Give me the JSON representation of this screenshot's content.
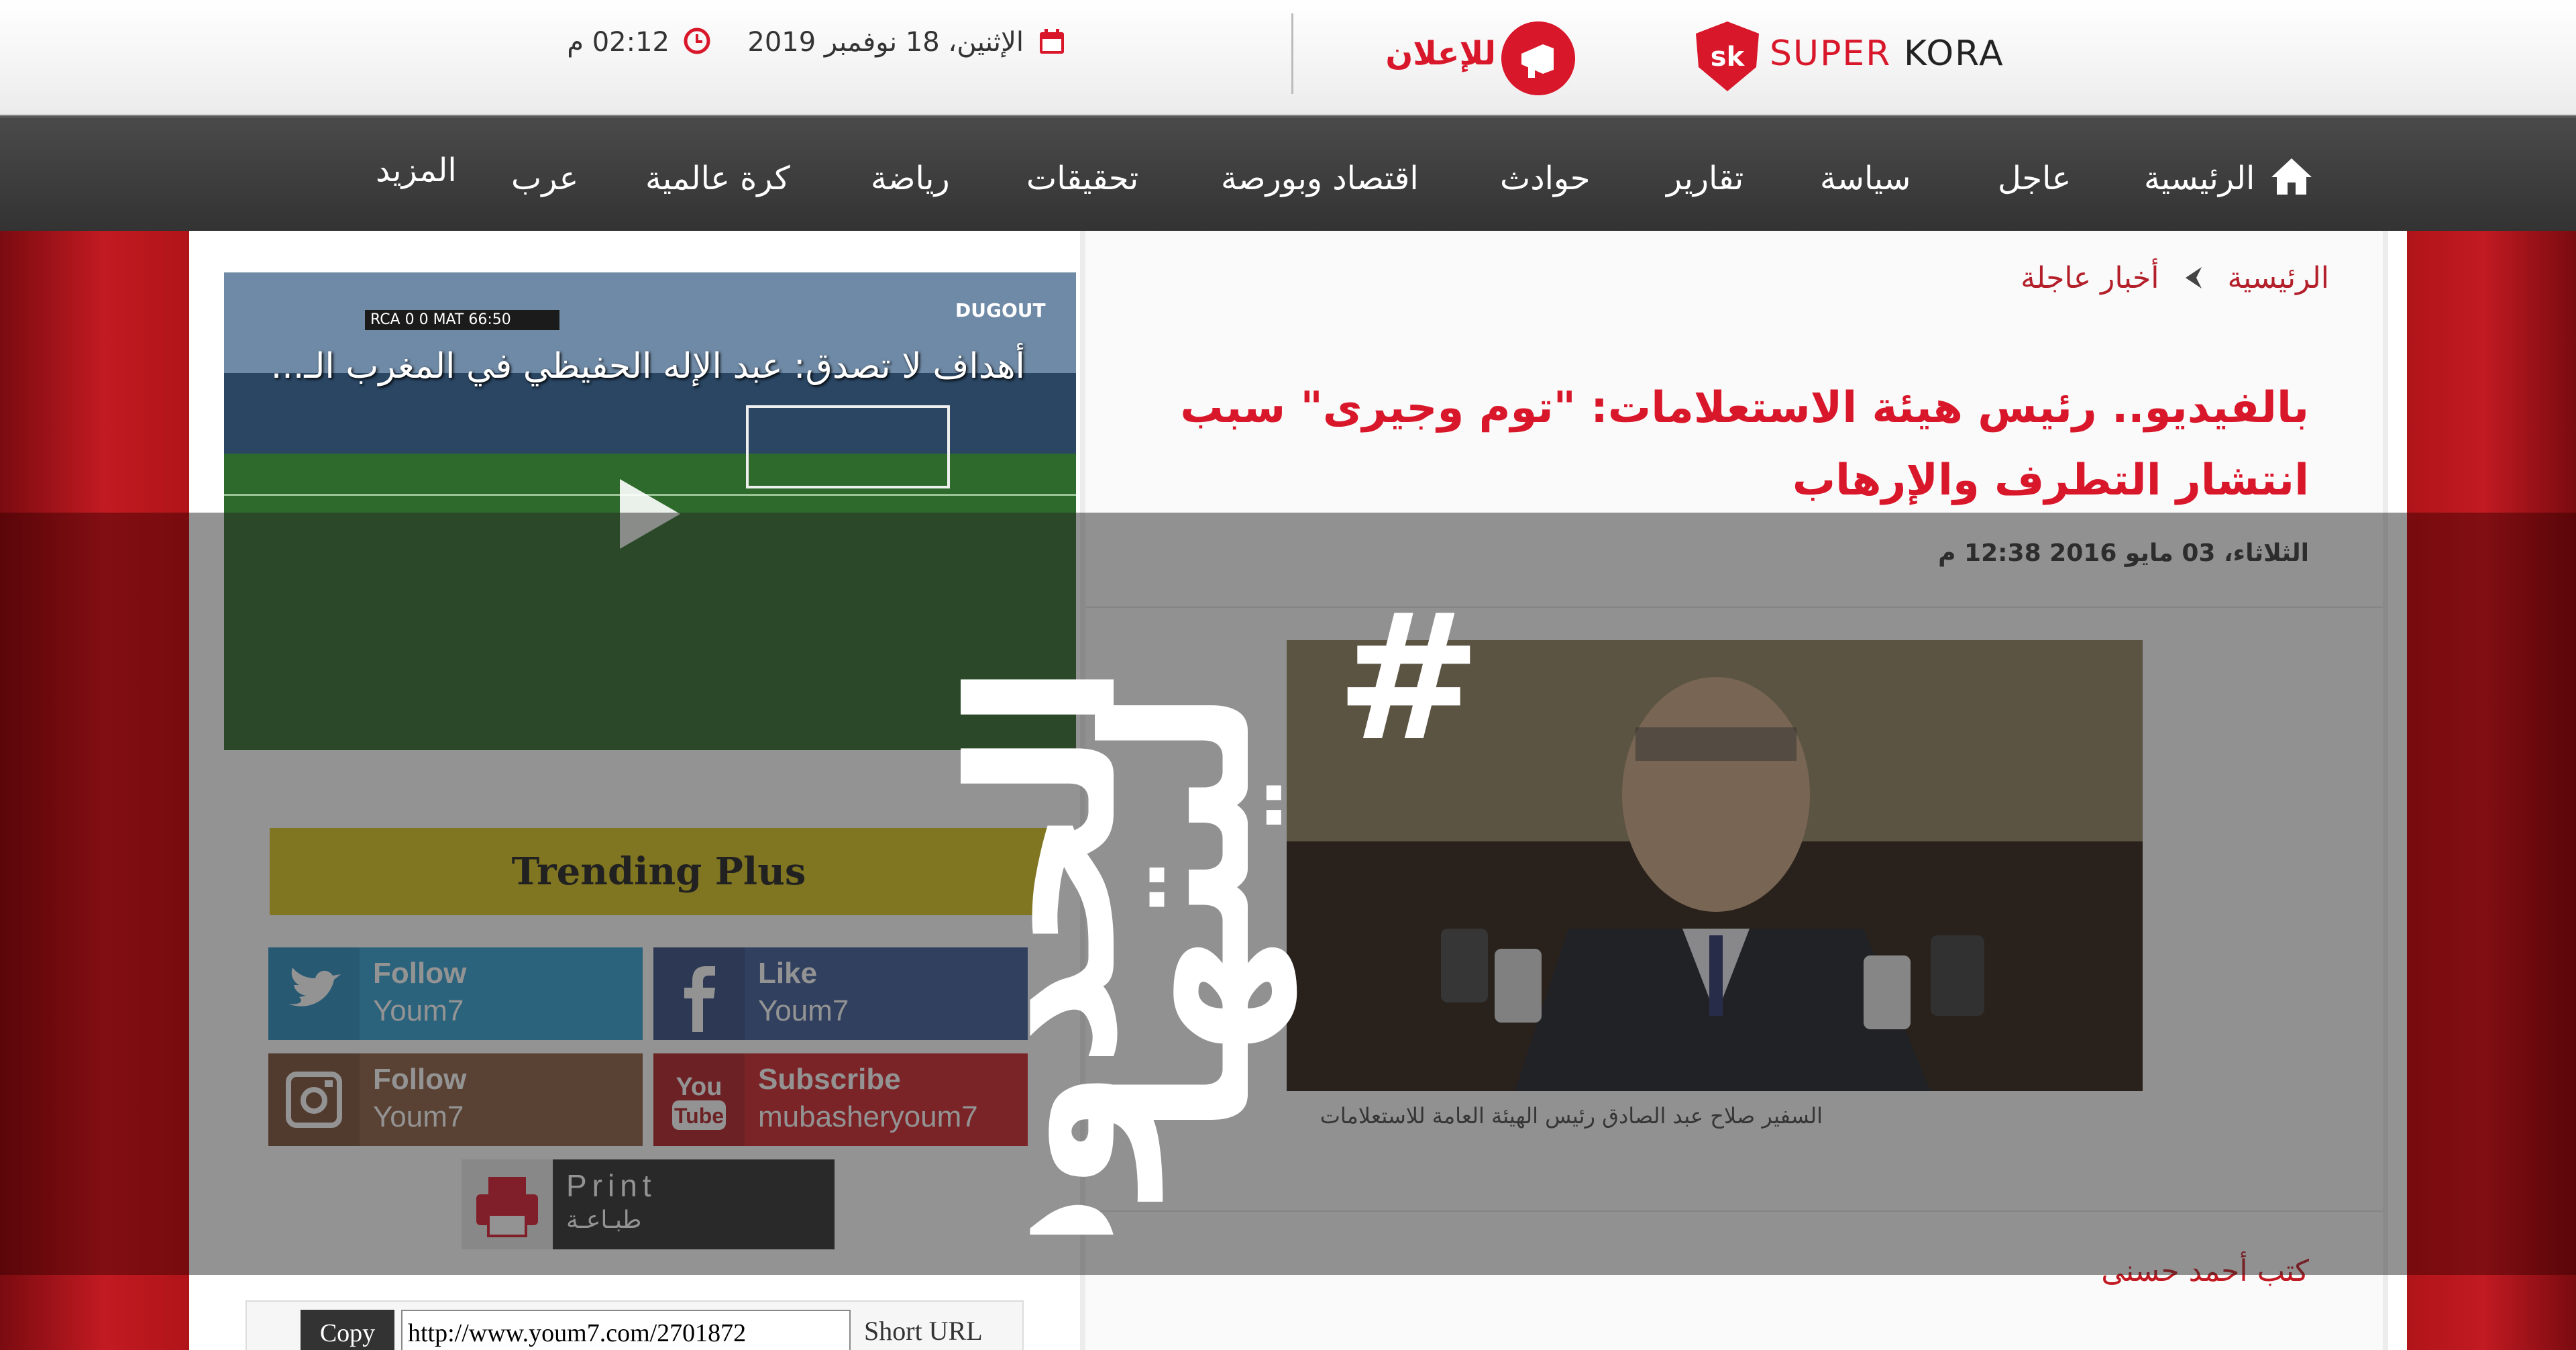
{
  "header": {
    "brand": {
      "name_part1": "SUPER",
      "name_part2": "KORA",
      "logo_text": "sk"
    },
    "advertise_label": "للإعلان",
    "date": "الإثنين، 18 نوفمبر 2019",
    "time": "02:12 م"
  },
  "nav": {
    "items": [
      {
        "label": "الرئيسية"
      },
      {
        "label": "عاجل"
      },
      {
        "label": "سياسة"
      },
      {
        "label": "تقارير"
      },
      {
        "label": "حوادث"
      },
      {
        "label": "اقتصاد وبورصة"
      },
      {
        "label": "تحقيقات"
      },
      {
        "label": "رياضة"
      },
      {
        "label": "كرة عالمية"
      },
      {
        "label": "عرب"
      },
      {
        "label": "المزيد"
      }
    ]
  },
  "article": {
    "breadcrumb": [
      "الرئيسية",
      "أخبار عاجلة"
    ],
    "headline": "بالفيديو.. رئيس هيئة الاستعلامات: \"توم وجيرى\" سبب انتشار التطرف والإرهاب",
    "published": "الثلاثاء، 03 مايو 2016 12:38 م",
    "photo_caption": "السفير صلاح عبد الصادق رئيس الهيئة العامة للاستعلامات",
    "author": "كتب أحمد حسنى"
  },
  "sidebar": {
    "video": {
      "title": "أهداف لا تصدق: عبد الإله الحفيظي في المغرب الـ...",
      "score": "RCA 0  0 MAT  66:50",
      "brand": "DUGOUT"
    },
    "trending_label": "Trending Plus",
    "social": [
      {
        "line1": "Follow",
        "line2": "Youm7"
      },
      {
        "line1": "Like",
        "line2": "Youm7"
      },
      {
        "line1": "Follow",
        "line2": "Youm7"
      },
      {
        "line1": "Subscribe",
        "line2": "mubasheryoum7"
      }
    ],
    "print": {
      "line1": "Print",
      "line2": "طبـاعـة"
    },
    "short_url": {
      "copy_label": "Copy",
      "value": "http://www.youm7.com/2701872",
      "label": "Short URL"
    }
  },
  "overlay": {
    "hashtag": "#",
    "line1": "ليتها",
    "line2": "الحدود"
  },
  "colors": {
    "brand_red": "#d9172a",
    "nav_bg": "#3c3c3c",
    "trending_yellow": "#d8c21b"
  }
}
